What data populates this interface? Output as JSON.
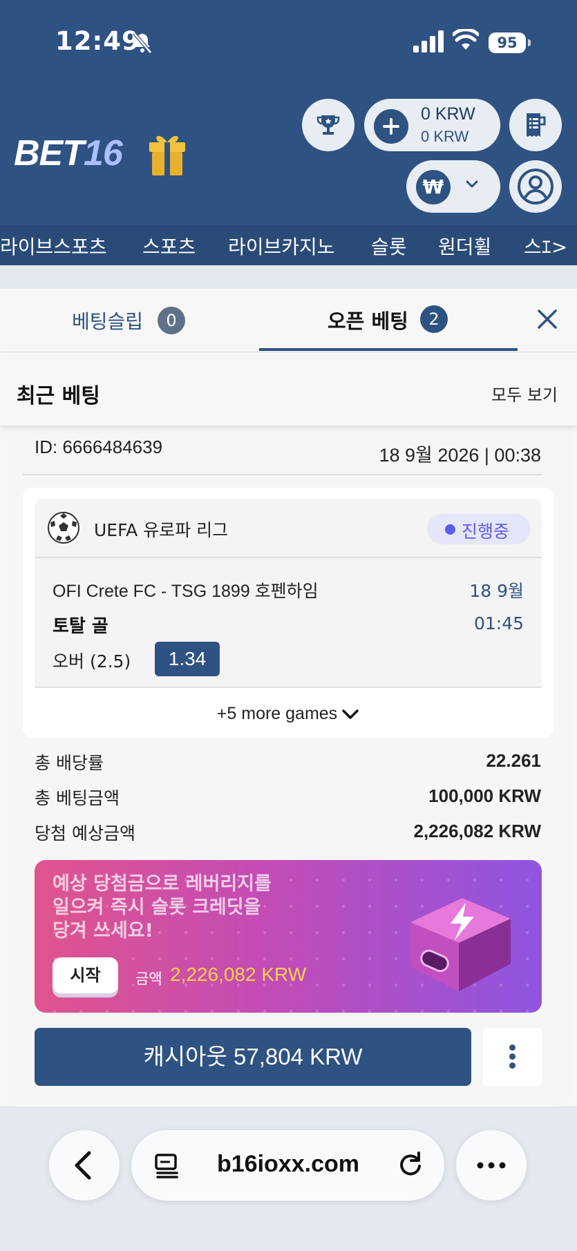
{
  "status_bar": {
    "time": "12:49",
    "battery": "95"
  },
  "header": {
    "logo_bet": "BET",
    "logo_16": "16",
    "balance_main": "0 KRW",
    "balance_sub": "0 KRW",
    "currency_symbol": "₩"
  },
  "nav": {
    "items": [
      "라이브스포츠",
      "스포츠",
      "라이브카지노",
      "슬롯",
      "원더휠",
      "스ｴ>"
    ]
  },
  "tabs": {
    "bet_slip_label": "베팅슬립",
    "bet_slip_count": "0",
    "open_bets_label": "오픈 베팅",
    "open_bets_count": "2"
  },
  "recent": {
    "title": "최근 베팅",
    "view_all": "모두 보기"
  },
  "bet": {
    "id": "ID: 6666484639",
    "date": "18 9월 2026 | 00:38",
    "league": "UEFA 유로파 리그",
    "status": "진행중",
    "match": "OFI Crete FC - TSG 1899 호펜하임",
    "match_date": "18 9월",
    "match_time": "01:45",
    "market": "토탈 골",
    "selection": "오버 (2.5)",
    "odds": "1.34",
    "more_games": "+5 more games",
    "total_odds_label": "총 배당률",
    "total_odds": "22.261",
    "total_stake_label": "총 베팅금액",
    "total_stake": "100,000 KRW",
    "potential_win_label": "당첨 예상금액",
    "potential_win": "2,226,082 KRW"
  },
  "promo": {
    "text": "예상 당첨금으로 레버리지를 일으켜 즉시 슬롯 크레딧을 당겨 쓰세요!",
    "start_button": "시작",
    "amount_label": "금액",
    "amount_value": "2,226,082 KRW"
  },
  "cashout": {
    "label": "캐시아웃 57,804 KRW"
  },
  "browser": {
    "url": "b16ioxx.com"
  },
  "colors": {
    "brand": "#2e5282",
    "live": "#5a5ee8",
    "promo_amount": "#ffd24a"
  }
}
